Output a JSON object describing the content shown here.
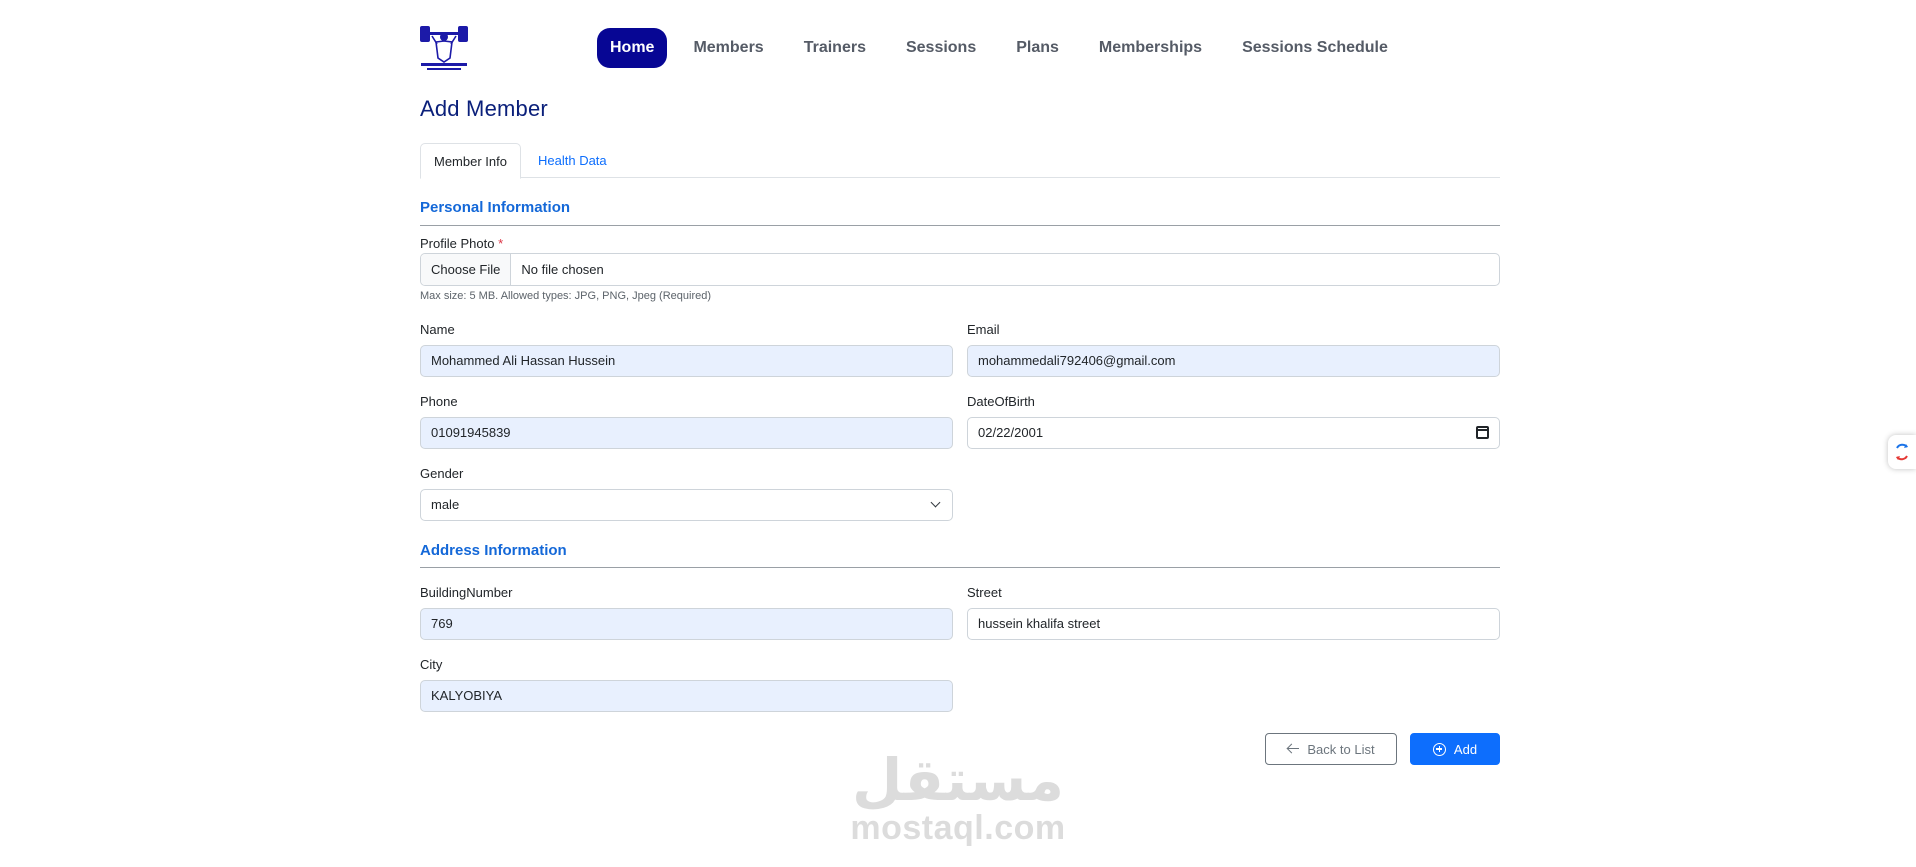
{
  "navbar": {
    "items": [
      {
        "label": "Home",
        "active": true
      },
      {
        "label": "Members",
        "active": false
      },
      {
        "label": "Trainers",
        "active": false
      },
      {
        "label": "Sessions",
        "active": false
      },
      {
        "label": "Plans",
        "active": false
      },
      {
        "label": "Memberships",
        "active": false
      },
      {
        "label": "Sessions Schedule",
        "active": false
      }
    ],
    "active_color": "#070694"
  },
  "page": {
    "title": "Add Member"
  },
  "tabs": [
    {
      "label": "Member Info",
      "active": true
    },
    {
      "label": "Health Data",
      "active": false
    }
  ],
  "personal": {
    "section_title": "Personal Information",
    "profile_photo": {
      "label": "Profile Photo",
      "required_mark": "*",
      "button_label": "Choose File",
      "status": "No file chosen",
      "hint": "Max size: 5 MB. Allowed types: JPG, PNG, Jpeg (Required)"
    },
    "name": {
      "label": "Name",
      "value": "Mohammed Ali Hassan Hussein"
    },
    "email": {
      "label": "Email",
      "value": "mohammedali792406@gmail.com"
    },
    "phone": {
      "label": "Phone",
      "value": "01091945839"
    },
    "dob": {
      "label": "DateOfBirth",
      "value": "02/22/2001"
    },
    "gender": {
      "label": "Gender",
      "value": "male"
    }
  },
  "address": {
    "section_title": "Address Information",
    "building": {
      "label": "BuildingNumber",
      "value": "769"
    },
    "street": {
      "label": "Street",
      "value": "hussein khalifa street"
    },
    "city": {
      "label": "City",
      "value": "KALYOBIYA"
    }
  },
  "actions": {
    "back_label": "Back to List",
    "add_label": "Add"
  },
  "watermark": {
    "arabic": "مستقل",
    "latin": "mostaql.com"
  },
  "colors": {
    "accent": "#0d6efd",
    "section": "#1468d8",
    "title": "#0a1f7a",
    "autofill": "#e8f0fe"
  }
}
